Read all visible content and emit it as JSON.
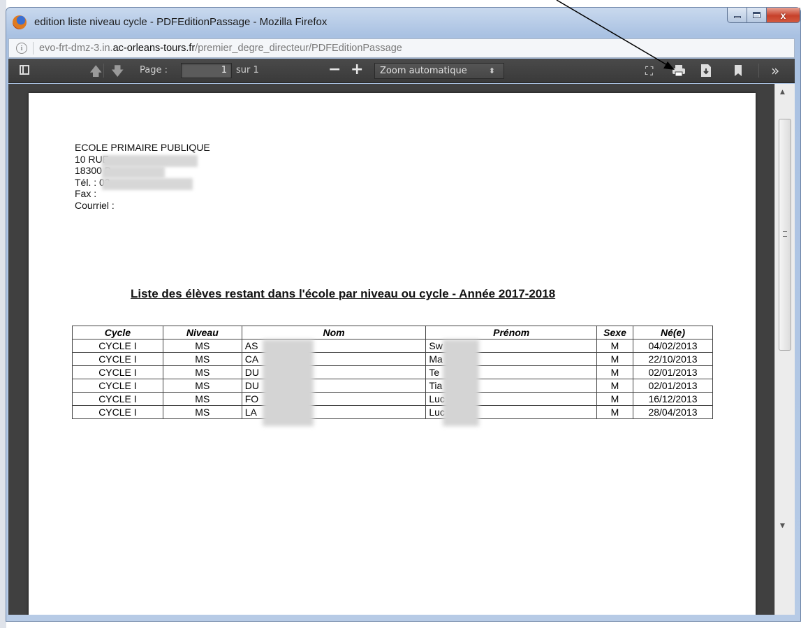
{
  "window": {
    "title": "edition liste niveau cycle - PDFEditionPassage - Mozilla Firefox",
    "minimize_label": "",
    "close_glyph": "x"
  },
  "urlbar": {
    "url_prefix": "evo-frt-dmz-3.in.",
    "url_domain": "ac-orleans-tours.fr",
    "url_path": "/premier_degre_directeur/PDFEditionPassage",
    "info_glyph": "i"
  },
  "toolbar": {
    "page_label": "Page :",
    "page_value": "1",
    "page_total": "sur 1",
    "zoom_out": "−",
    "zoom_in": "+",
    "zoom_value": "Zoom automatique",
    "tools_glyph": "»"
  },
  "document": {
    "address": [
      "ECOLE PRIMAIRE PUBLIQUE",
      "10 RUE",
      "18300 B",
      "Tél. : 02",
      "Fax :",
      "Courriel :"
    ],
    "title": "Liste des élèves restant dans l'école par niveau ou cycle - Année 2017-2018",
    "table": {
      "headers": [
        "Cycle",
        "Niveau",
        "Nom",
        "Prénom",
        "Sexe",
        "Né(e)"
      ],
      "rows": [
        [
          "CYCLE I",
          "MS",
          "AS",
          "Sw",
          "M",
          "04/02/2013"
        ],
        [
          "CYCLE I",
          "MS",
          "CA",
          "Ma",
          "M",
          "22/10/2013"
        ],
        [
          "CYCLE I",
          "MS",
          "DU",
          "Te",
          "M",
          "02/01/2013"
        ],
        [
          "CYCLE I",
          "MS",
          "DU",
          "Tia",
          "M",
          "02/01/2013"
        ],
        [
          "CYCLE I",
          "MS",
          "FO",
          "Luc",
          "M",
          "16/12/2013"
        ],
        [
          "CYCLE I",
          "MS",
          "LA",
          "Luc",
          "M",
          "28/04/2013"
        ]
      ]
    }
  },
  "icons": {
    "browser": "firefox-icon",
    "sidebar": "sidebar-toggle-icon",
    "previous": "arrow-up-icon",
    "next": "arrow-down-icon",
    "presentation": "presentation-mode-icon",
    "print": "print-icon",
    "download": "save-icon",
    "bookmark": "bookmark-icon",
    "tools": "tools-icon"
  },
  "colors": {
    "toolbar_bg": "#3f3f3f",
    "viewer_bg": "#404040",
    "close_button": "#c7412b"
  }
}
